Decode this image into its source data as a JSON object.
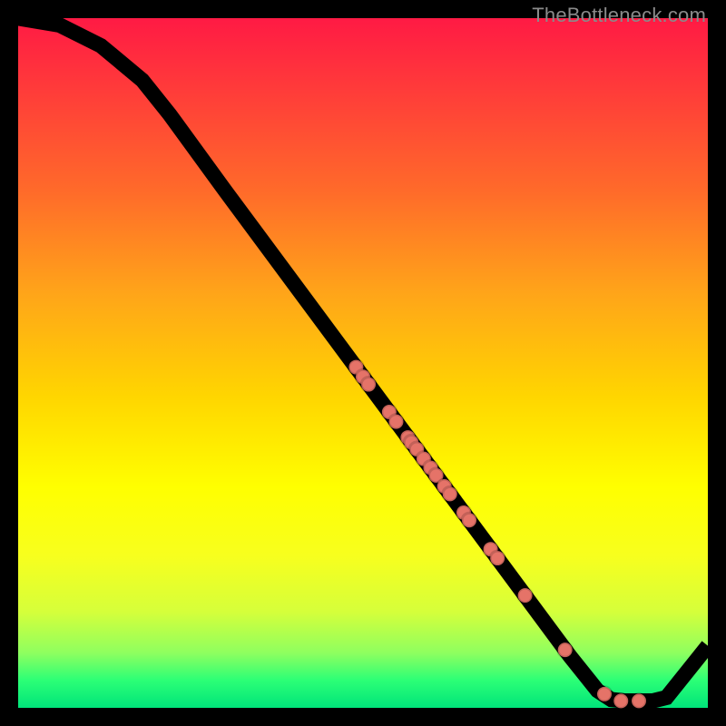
{
  "watermark": "TheBottleneck.com",
  "chart_data": {
    "type": "line",
    "title": "",
    "xlabel": "",
    "ylabel": "",
    "xlim": [
      0,
      100
    ],
    "ylim": [
      0,
      100
    ],
    "grid": false,
    "curve": [
      {
        "x": 0,
        "y": 100
      },
      {
        "x": 6,
        "y": 99
      },
      {
        "x": 12,
        "y": 96
      },
      {
        "x": 18,
        "y": 91
      },
      {
        "x": 22,
        "y": 86
      },
      {
        "x": 30,
        "y": 75
      },
      {
        "x": 40,
        "y": 61.5
      },
      {
        "x": 50,
        "y": 48
      },
      {
        "x": 60,
        "y": 34.5
      },
      {
        "x": 70,
        "y": 21
      },
      {
        "x": 80,
        "y": 7.5
      },
      {
        "x": 84,
        "y": 2.5
      },
      {
        "x": 86,
        "y": 1.2
      },
      {
        "x": 88,
        "y": 1.0
      },
      {
        "x": 92,
        "y": 1.0
      },
      {
        "x": 94,
        "y": 1.5
      },
      {
        "x": 100,
        "y": 9
      }
    ],
    "points": [
      {
        "x": 49.0,
        "y": 49.4
      },
      {
        "x": 50.0,
        "y": 48.0
      },
      {
        "x": 50.8,
        "y": 46.9
      },
      {
        "x": 53.8,
        "y": 42.9
      },
      {
        "x": 54.8,
        "y": 41.5
      },
      {
        "x": 56.5,
        "y": 39.2
      },
      {
        "x": 57.0,
        "y": 38.5
      },
      {
        "x": 57.8,
        "y": 37.5
      },
      {
        "x": 58.8,
        "y": 36.1
      },
      {
        "x": 59.8,
        "y": 34.8
      },
      {
        "x": 60.6,
        "y": 33.7
      },
      {
        "x": 61.8,
        "y": 32.1
      },
      {
        "x": 62.6,
        "y": 31.0
      },
      {
        "x": 64.6,
        "y": 28.3
      },
      {
        "x": 65.4,
        "y": 27.2
      },
      {
        "x": 68.5,
        "y": 23.0
      },
      {
        "x": 69.5,
        "y": 21.7
      },
      {
        "x": 73.5,
        "y": 16.3
      },
      {
        "x": 79.3,
        "y": 8.4
      },
      {
        "x": 85.0,
        "y": 2.0
      },
      {
        "x": 87.4,
        "y": 1.0
      },
      {
        "x": 90.0,
        "y": 1.0
      }
    ],
    "colors": {
      "curve": "#000000",
      "point": "#e57368"
    }
  }
}
